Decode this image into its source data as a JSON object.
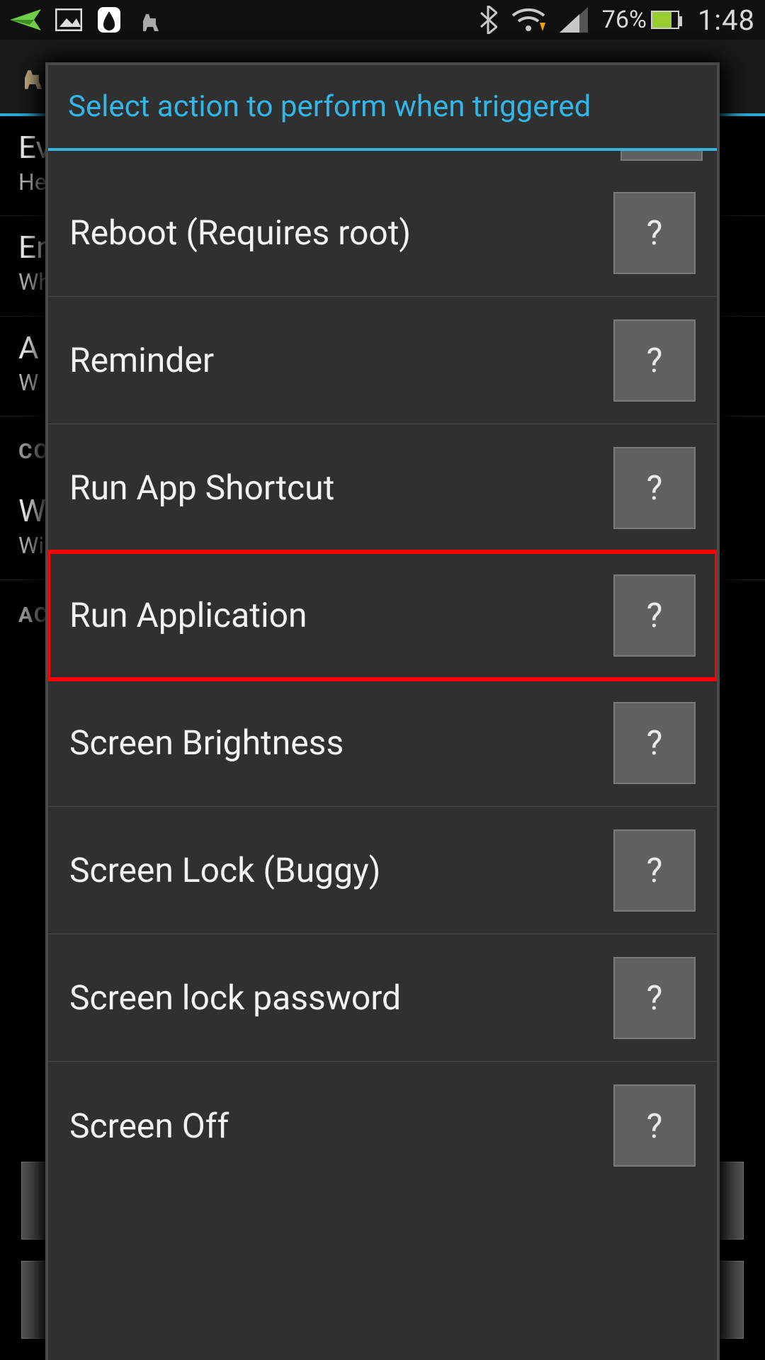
{
  "status": {
    "battery_pct": "76%",
    "clock": "1:48",
    "icons_left": [
      "paper-plane-icon",
      "picture-icon",
      "drop-icon",
      "llama-icon"
    ],
    "icons_right": [
      "bluetooth-icon",
      "wifi-download-icon",
      "cell-signal-icon"
    ]
  },
  "background": {
    "items": [
      {
        "title": "Ev",
        "sub": "Hea"
      },
      {
        "title": "En",
        "sub": "Wh\nanc"
      },
      {
        "title": "A",
        "sub": "W\nco"
      }
    ],
    "heading1": "CO",
    "wifi_title": "Wi",
    "wifi_sub": "Wi",
    "heading2": "AC"
  },
  "dialog": {
    "title": "Select action to perform when triggered",
    "help_label": "?",
    "actions": [
      {
        "label": "Reboot (Requires root)",
        "highlight": false
      },
      {
        "label": "Reminder",
        "highlight": false
      },
      {
        "label": "Run App Shortcut",
        "highlight": false
      },
      {
        "label": "Run Application",
        "highlight": true
      },
      {
        "label": "Screen Brightness",
        "highlight": false
      },
      {
        "label": "Screen Lock (Buggy)",
        "highlight": false
      },
      {
        "label": "Screen lock password",
        "highlight": false
      },
      {
        "label": "Screen Off",
        "highlight": false
      }
    ]
  }
}
